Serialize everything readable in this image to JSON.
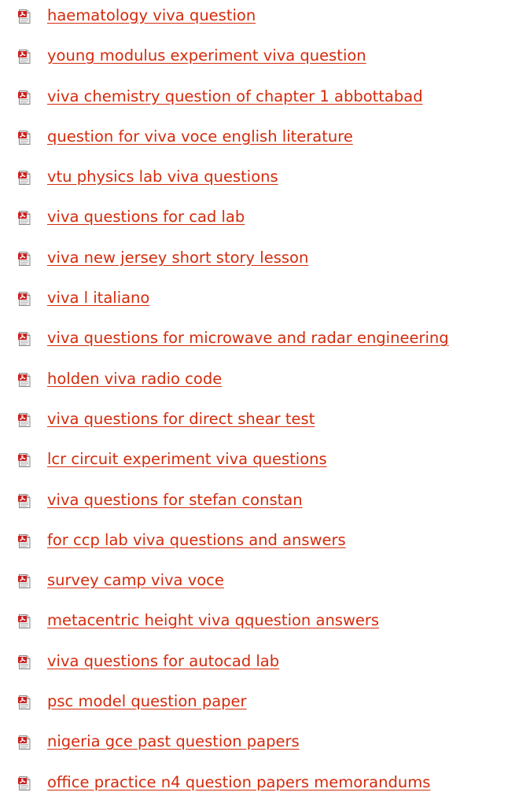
{
  "links": [
    {
      "label": "haematology viva question",
      "icon": "pdf-document-icon"
    },
    {
      "label": "young modulus experiment viva question",
      "icon": "pdf-document-icon"
    },
    {
      "label": "viva chemistry question of chapter 1 abbottabad",
      "icon": "pdf-document-icon"
    },
    {
      "label": "question for viva voce english literature",
      "icon": "pdf-document-icon"
    },
    {
      "label": "vtu physics lab viva questions",
      "icon": "pdf-document-icon"
    },
    {
      "label": "viva questions for cad lab",
      "icon": "pdf-document-icon"
    },
    {
      "label": "viva new jersey short story lesson",
      "icon": "pdf-document-icon"
    },
    {
      "label": "viva l italiano",
      "icon": "pdf-document-icon"
    },
    {
      "label": "viva questions for microwave and radar engineering",
      "icon": "pdf-document-icon"
    },
    {
      "label": "holden viva radio code",
      "icon": "pdf-document-icon"
    },
    {
      "label": "viva questions for direct shear test",
      "icon": "pdf-document-icon"
    },
    {
      "label": "lcr circuit experiment viva questions",
      "icon": "pdf-document-icon"
    },
    {
      "label": "viva questions for stefan constan",
      "icon": "pdf-document-icon"
    },
    {
      "label": "for ccp lab viva questions and answers",
      "icon": "pdf-document-icon"
    },
    {
      "label": "survey camp viva voce",
      "icon": "pdf-document-icon"
    },
    {
      "label": "metacentric height viva qquestion answers",
      "icon": "pdf-document-icon"
    },
    {
      "label": "viva questions for autocad lab",
      "icon": "pdf-document-icon"
    },
    {
      "label": "psc model question paper",
      "icon": "pdf-document-icon"
    },
    {
      "label": "nigeria gce past question papers",
      "icon": "pdf-document-icon"
    },
    {
      "label": "office practice n4 question papers memorandums",
      "icon": "pdf-document-icon"
    }
  ],
  "colors": {
    "link": "#d42b0c",
    "icon_red": "#cc1f1f",
    "icon_paper": "#f2f2f2",
    "icon_border": "#8a8a8a"
  }
}
